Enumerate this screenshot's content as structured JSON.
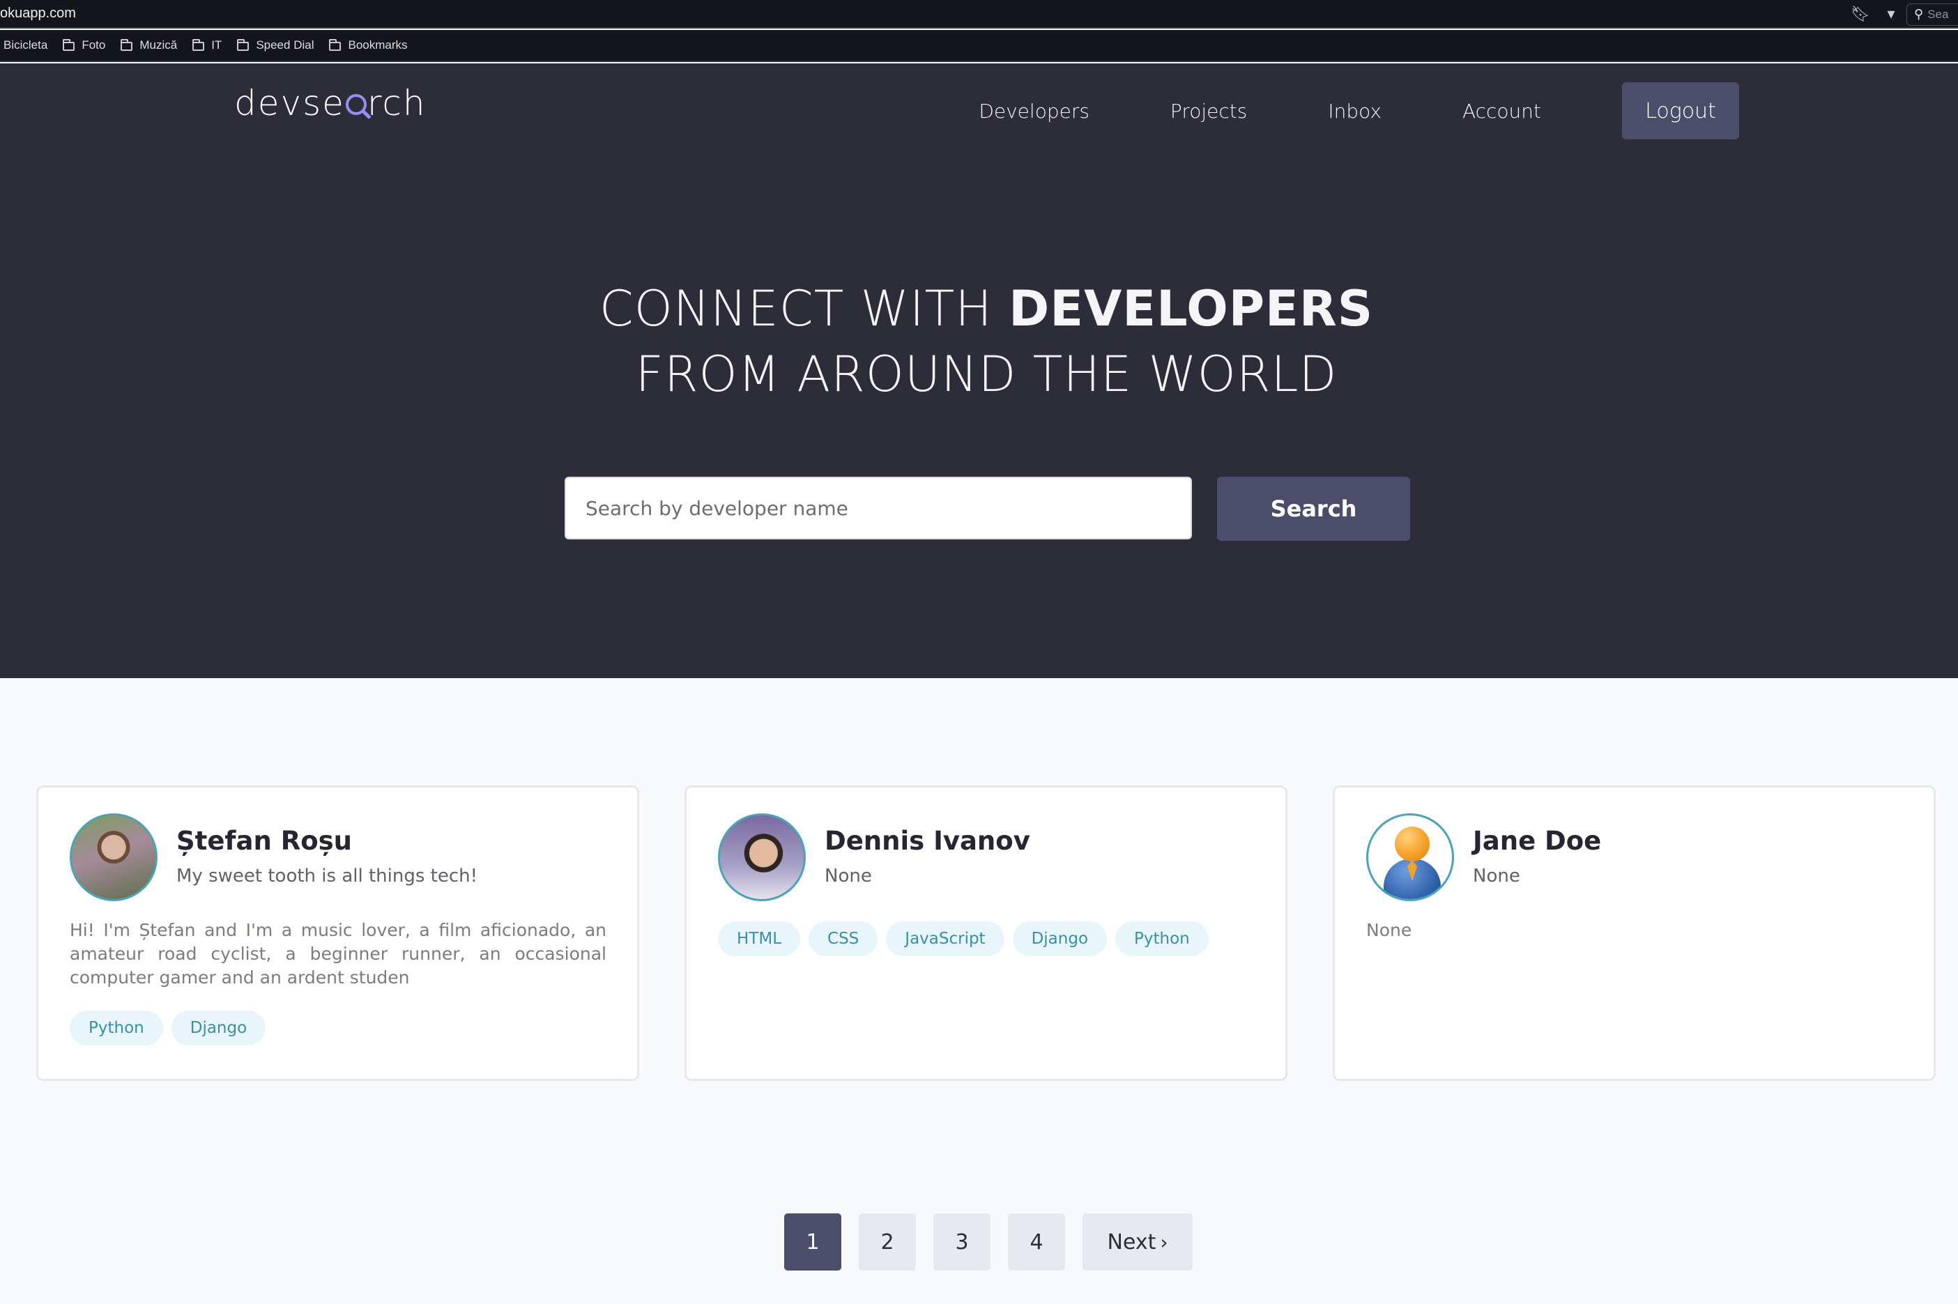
{
  "browser": {
    "url": "okuapp.com",
    "search_placeholder": "Sea",
    "bookmarks": [
      "Bicicleta",
      "Foto",
      "Muzică",
      "IT",
      "Speed Dial",
      "Bookmarks"
    ]
  },
  "header": {
    "logo_text_left": "devse",
    "logo_text_right": "rch",
    "nav": [
      "Developers",
      "Projects",
      "Inbox",
      "Account"
    ],
    "logout_label": "Logout"
  },
  "hero": {
    "line1_light": "CONNECT WITH ",
    "line1_bold": "DEVELOPERS",
    "line2": "FROM AROUND THE WORLD",
    "search_placeholder": "Search by developer name",
    "search_button": "Search"
  },
  "developers": [
    {
      "name": "Ștefan Roșu",
      "tagline": "My sweet tooth is all things tech!",
      "bio": "Hi! I'm Ștefan and I'm a music lover, a film aficionado, an amateur road cyclist, a beginner runner, an occasional computer gamer and an ardent studen",
      "skills": [
        "Python",
        "Django"
      ]
    },
    {
      "name": "Dennis Ivanov",
      "tagline": "None",
      "bio": "",
      "skills": [
        "HTML",
        "CSS",
        "JavaScript",
        "Django",
        "Python"
      ]
    },
    {
      "name": "Jane Doe",
      "tagline": "None",
      "bio": "None",
      "skills": []
    }
  ],
  "pagination": {
    "pages": [
      "1",
      "2",
      "3",
      "4"
    ],
    "active_page": "1",
    "next_label": "Next"
  },
  "colors": {
    "header_bg": "#2d2d39",
    "accent": "#4b4e6b",
    "page_bg": "#f8f9fd",
    "tag_bg": "#e8f6fb",
    "tag_text": "#3a8fa4"
  }
}
